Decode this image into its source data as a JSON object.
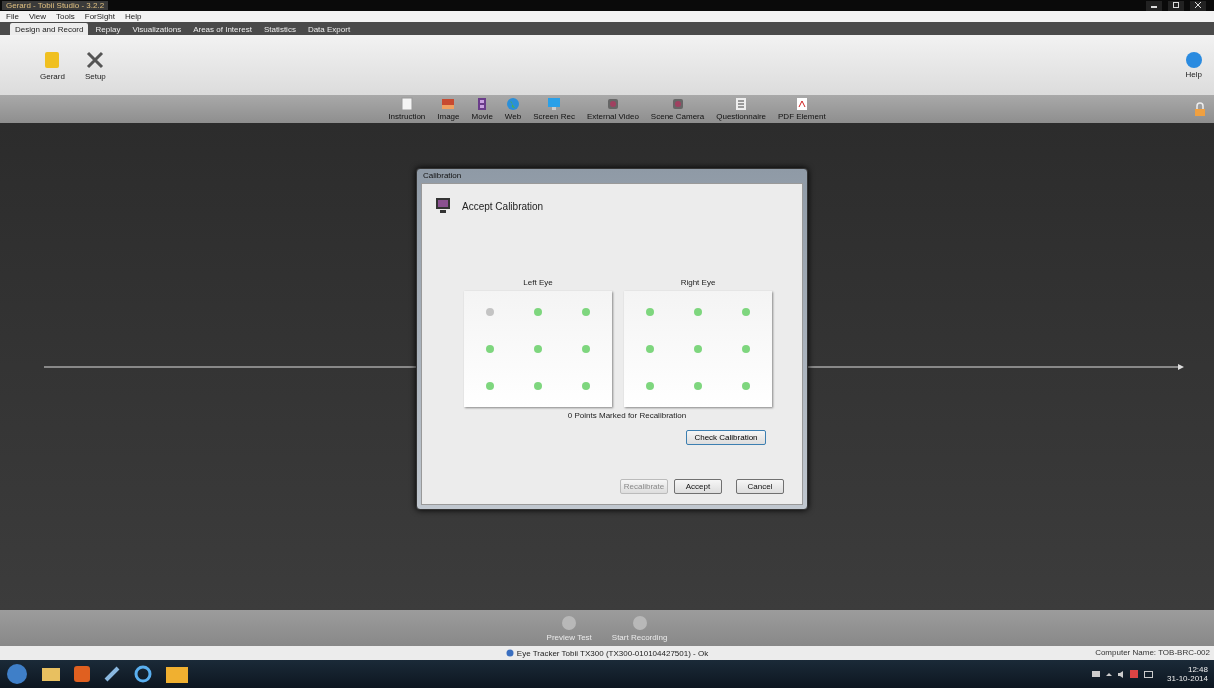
{
  "window": {
    "title": "Gerard - Tobii Studio - 3.2.2"
  },
  "menu": [
    "File",
    "View",
    "Tools",
    "ForSight",
    "Help"
  ],
  "tabs": [
    {
      "label": "Design and Record",
      "selected": true
    },
    {
      "label": "Replay",
      "selected": false
    },
    {
      "label": "Visualizations",
      "selected": false
    },
    {
      "label": "Areas of Interest",
      "selected": false
    },
    {
      "label": "Statistics",
      "selected": false
    },
    {
      "label": "Data Export",
      "selected": false
    }
  ],
  "ribbon": {
    "items": [
      {
        "label": "Gerard",
        "kind": "folder"
      },
      {
        "label": "Setup",
        "kind": "tools"
      }
    ],
    "help": "Help"
  },
  "elements": [
    {
      "label": "Instruction",
      "kind": "doc"
    },
    {
      "label": "Image",
      "kind": "image"
    },
    {
      "label": "Movie",
      "kind": "movie"
    },
    {
      "label": "Web",
      "kind": "globe"
    },
    {
      "label": "Screen Rec",
      "kind": "monitor"
    },
    {
      "label": "External Video",
      "kind": "camera"
    },
    {
      "label": "Scene Camera",
      "kind": "camera"
    },
    {
      "label": "Questionnaire",
      "kind": "list"
    },
    {
      "label": "PDF Element",
      "kind": "pdf"
    }
  ],
  "dialog": {
    "title": "Calibration",
    "heading": "Accept Calibration",
    "eyes": [
      {
        "label": "Left Eye",
        "points": [
          false,
          true,
          true,
          true,
          true,
          true,
          true,
          true,
          true
        ]
      },
      {
        "label": "Right Eye",
        "points": [
          true,
          true,
          true,
          true,
          true,
          true,
          true,
          true,
          true
        ]
      }
    ],
    "marked": "0 Points Marked for Recalibration",
    "check": "Check Calibration",
    "buttons": [
      {
        "label": "Recalibrate",
        "disabled": true
      },
      {
        "label": "Accept",
        "disabled": false
      },
      {
        "label": "Cancel",
        "disabled": false
      }
    ]
  },
  "bottom": [
    {
      "label": "Preview Test",
      "disabled": true
    },
    {
      "label": "Start Recording",
      "disabled": true
    }
  ],
  "status_bar": {
    "tracker": "Eye Tracker Tobii TX300 (TX300-010104427501) - Ok",
    "computer": "Computer Name: TOB-BRC-002"
  },
  "taskbar": {
    "time": "12:48",
    "date": "31-10-2014"
  }
}
